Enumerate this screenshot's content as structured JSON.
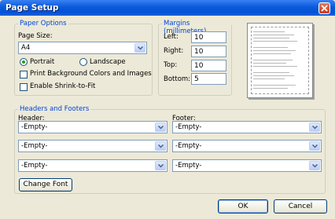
{
  "window": {
    "title": "Page Setup"
  },
  "paper_options": {
    "legend": "Paper Options",
    "page_size_label": "Page Size:",
    "page_size_value": "A4",
    "portrait_label": "Portrait",
    "landscape_label": "Landscape",
    "orientation_selected": "Portrait",
    "print_background_label": "Print Background Colors and Images",
    "print_background_checked": false,
    "shrink_to_fit_label": "Enable Shrink-to-Fit",
    "shrink_to_fit_checked": false
  },
  "margins": {
    "legend": "Margins (millimeters)",
    "left_label": "Left:",
    "left_value": "10",
    "right_label": "Right:",
    "right_value": "10",
    "top_label": "Top:",
    "top_value": "10",
    "bottom_label": "Bottom:",
    "bottom_value": "5"
  },
  "headers_footers": {
    "legend": "Headers and Footers",
    "header_label": "Header:",
    "footer_label": "Footer:",
    "header_values": [
      "-Empty-",
      "-Empty-",
      "-Empty-"
    ],
    "footer_values": [
      "-Empty-",
      "-Empty-",
      "-Empty-"
    ],
    "change_font_label": "Change Font"
  },
  "buttons": {
    "ok_label": "OK",
    "cancel_label": "Cancel"
  },
  "icons": {
    "close": "close-icon",
    "dropdown": "chevron-down-icon"
  },
  "colors": {
    "title_bar": "#0a5adb",
    "legend_text": "#0046d5",
    "close_button": "#c93a1b"
  }
}
